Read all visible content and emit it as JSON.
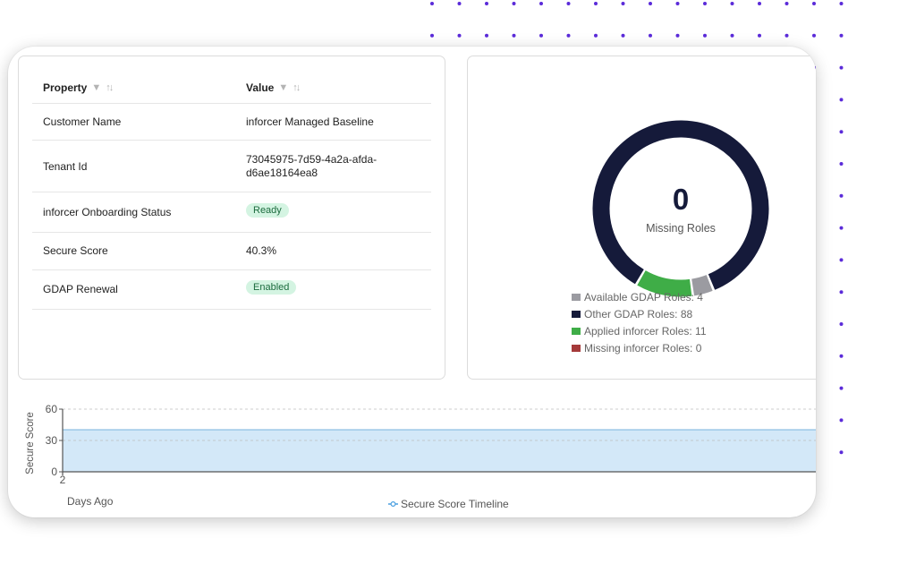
{
  "properties_table": {
    "headers": {
      "property": "Property",
      "value": "Value"
    },
    "rows": [
      {
        "property": "Customer Name",
        "value": "inforcer Managed Baseline"
      },
      {
        "property": "Tenant Id",
        "value_line1": "73045975-7d59-4a2a-afda-",
        "value_line2": "d6ae18164ea8"
      },
      {
        "property": "inforcer Onboarding Status",
        "badge": "Ready"
      },
      {
        "property": "Secure Score",
        "value": "40.3%"
      },
      {
        "property": "GDAP Renewal",
        "badge": "Enabled"
      }
    ]
  },
  "roles_chart": {
    "center_value": "0",
    "center_label": "Missing Roles",
    "chart_data": {
      "type": "pie",
      "series": [
        {
          "label": "Available GDAP Roles: 4",
          "value": 4,
          "color": "#9b9ba1"
        },
        {
          "label": "Other GDAP Roles: 88",
          "value": 88,
          "color": "#151a3a"
        },
        {
          "label": "Applied inforcer Roles: 11",
          "value": 11,
          "color": "#3fad47"
        },
        {
          "label": "Missing inforcer Roles: 0",
          "value": 0,
          "color": "#a53a3a"
        }
      ]
    }
  },
  "score_chart": {
    "chart_data": {
      "type": "area",
      "ylabel": "Secure Score",
      "xlabel": "Days Ago",
      "y_ticks": [
        "60",
        "30",
        "0"
      ],
      "x_ticks": [
        "2"
      ],
      "ylim": [
        0,
        60
      ],
      "series": [
        {
          "name": "Secure Score Timeline",
          "values": [
            40.3
          ]
        }
      ],
      "fill_color": "#d3e8f8",
      "line_color": "#7ab3dc"
    }
  }
}
